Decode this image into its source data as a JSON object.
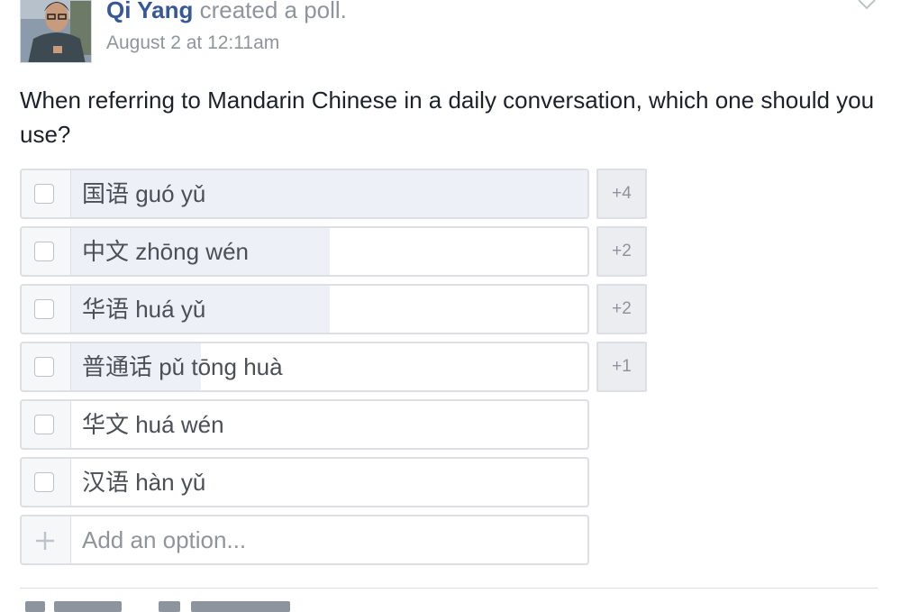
{
  "post": {
    "author": "Qi Yang",
    "action": "created a poll.",
    "timestamp": "August 2 at 12:11am",
    "question": "When referring to Mandarin Chinese in a daily conversation, which one should you use?"
  },
  "poll": {
    "options": [
      {
        "label": "国语 guó yǔ",
        "votes": "+4",
        "share": 1.0
      },
      {
        "label": "中文 zhōng wén",
        "votes": "+2",
        "share": 0.5
      },
      {
        "label": "华语 huá yǔ",
        "votes": "+2",
        "share": 0.5
      },
      {
        "label": "普通话 pǔ tōng huà",
        "votes": "+1",
        "share": 0.25
      },
      {
        "label": "华文 huá wén",
        "votes": "",
        "share": 0
      },
      {
        "label": "汉语 hàn yǔ",
        "votes": "",
        "share": 0
      }
    ],
    "add_option_placeholder": "Add an option..."
  },
  "colors": {
    "author": "#365899",
    "muted": "#90949c",
    "vote_fill": "#edf0f7",
    "border": "#dddfe2"
  },
  "icons": {
    "options_menu": "chevron-down-icon",
    "add_option": "plus-icon"
  }
}
